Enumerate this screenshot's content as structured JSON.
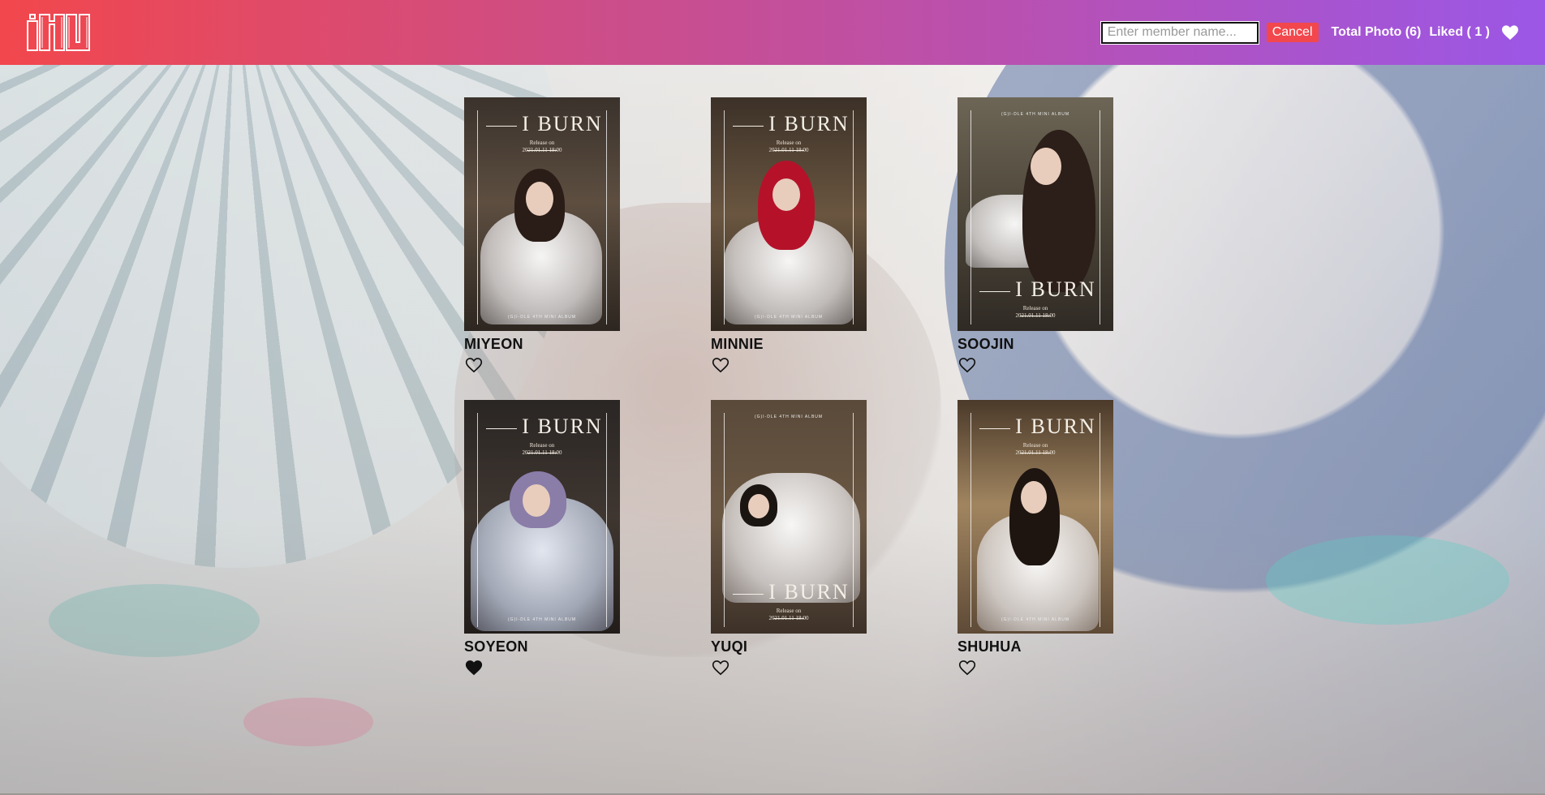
{
  "header": {
    "logo_icon": "gidle-logo",
    "search": {
      "placeholder": "Enter member name...",
      "value": ""
    },
    "cancel_label": "Cancel",
    "total_photo_label": "Total Photo (6)",
    "liked_label": "Liked ( 1 )",
    "liked_icon": "heart-filled-icon"
  },
  "photo_text": {
    "title": "I BURN",
    "release_line": "Release on",
    "release_date": "2021.01.11 18:00",
    "album_line": "(G)I-DLE 4TH MINI ALBUM"
  },
  "members": [
    {
      "name": "MIYEON",
      "liked": false
    },
    {
      "name": "MINNIE",
      "liked": false
    },
    {
      "name": "SOOJIN",
      "liked": false
    },
    {
      "name": "SOYEON",
      "liked": true
    },
    {
      "name": "YUQI",
      "liked": false
    },
    {
      "name": "SHUHUA",
      "liked": false
    }
  ],
  "colors": {
    "header_gradient_start": "#f2474c",
    "header_gradient_end": "#9b57e6",
    "cancel_button": "#f2474c",
    "text": "#111111"
  }
}
